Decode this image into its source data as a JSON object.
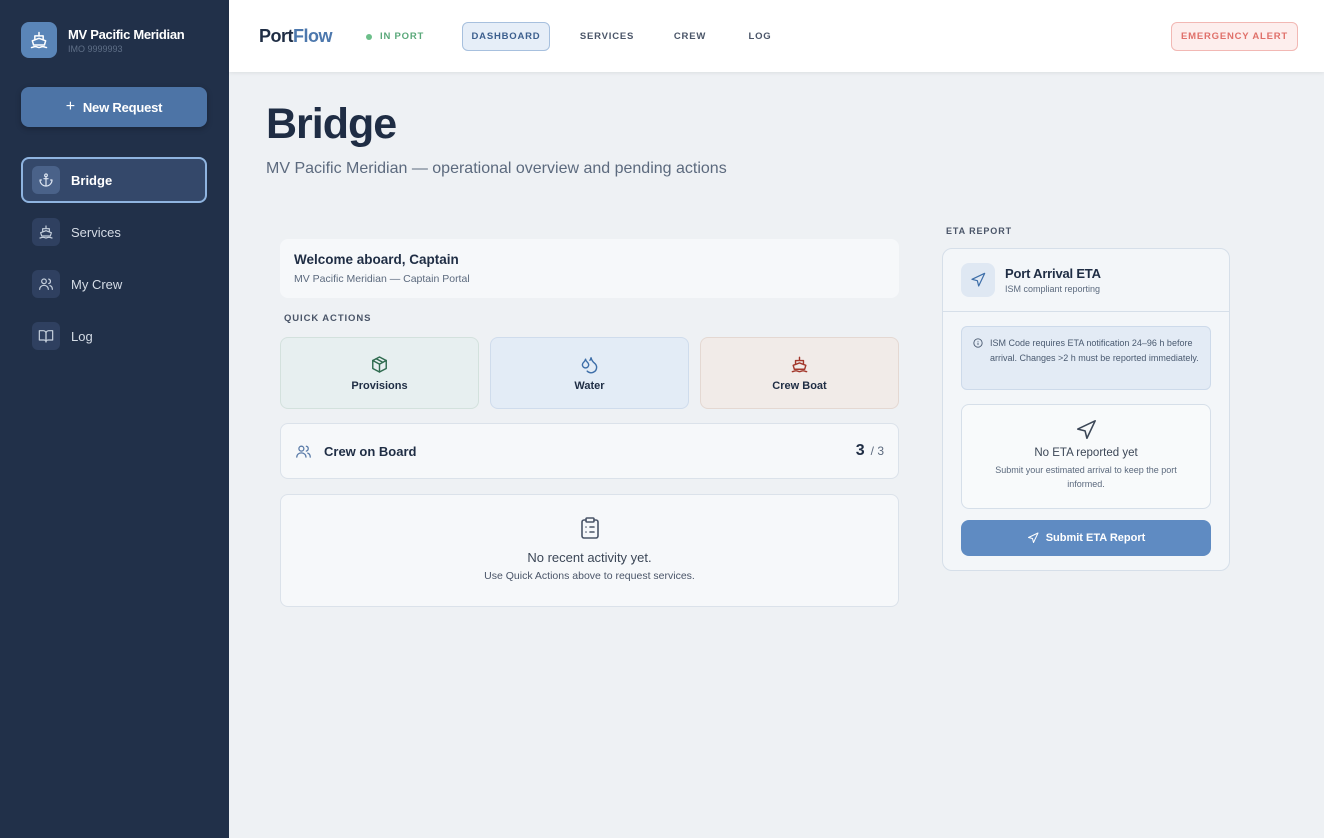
{
  "sidebar": {
    "vessel_name": "MV Pacific Meridian",
    "imo": "IMO 9999993",
    "new_request_label": "New Request",
    "items": [
      {
        "label": "Bridge",
        "icon": "anchor-icon",
        "active": true
      },
      {
        "label": "Services",
        "icon": "ship-icon",
        "active": false
      },
      {
        "label": "My Crew",
        "icon": "users-icon",
        "active": false
      },
      {
        "label": "Log",
        "icon": "book-icon",
        "active": false
      }
    ]
  },
  "topbar": {
    "logo_port": "Port",
    "logo_flow": "Flow",
    "status": "IN PORT",
    "tabs": [
      {
        "label": "DASHBOARD",
        "active": true
      },
      {
        "label": "SERVICES",
        "active": false
      },
      {
        "label": "CREW",
        "active": false
      },
      {
        "label": "LOG",
        "active": false
      }
    ],
    "emergency_label": "EMERGENCY ALERT"
  },
  "main": {
    "title": "Bridge",
    "subtitle": "MV Pacific Meridian — operational overview and pending actions",
    "welcome": {
      "title": "Welcome aboard, Captain",
      "subtitle": "MV Pacific Meridian — Captain Portal"
    },
    "quick_actions_label": "QUICK ACTIONS",
    "quick_actions": [
      {
        "label": "Provisions",
        "icon": "package-icon"
      },
      {
        "label": "Water",
        "icon": "droplets-icon"
      },
      {
        "label": "Crew Boat",
        "icon": "ship-icon"
      }
    ],
    "crew": {
      "label": "Crew on Board",
      "count": "3",
      "total": "/ 3"
    },
    "activity": {
      "title": "No recent activity yet.",
      "subtitle": "Use Quick Actions above to request services."
    }
  },
  "eta": {
    "section_label": "ETA REPORT",
    "title": "Port Arrival ETA",
    "subtitle": "ISM compliant reporting",
    "info": "ISM Code requires ETA notification 24–96 h before arrival. Changes >2 h must be reported immediately.",
    "empty_title": "No ETA reported yet",
    "empty_subtitle": "Submit your estimated arrival to keep the port informed.",
    "submit_label": "Submit ETA Report"
  },
  "colors": {
    "sidebar_bg": "#213049",
    "accent": "#5f8bc2",
    "status_green": "#5aa87a",
    "emergency_red": "#e0706a"
  }
}
